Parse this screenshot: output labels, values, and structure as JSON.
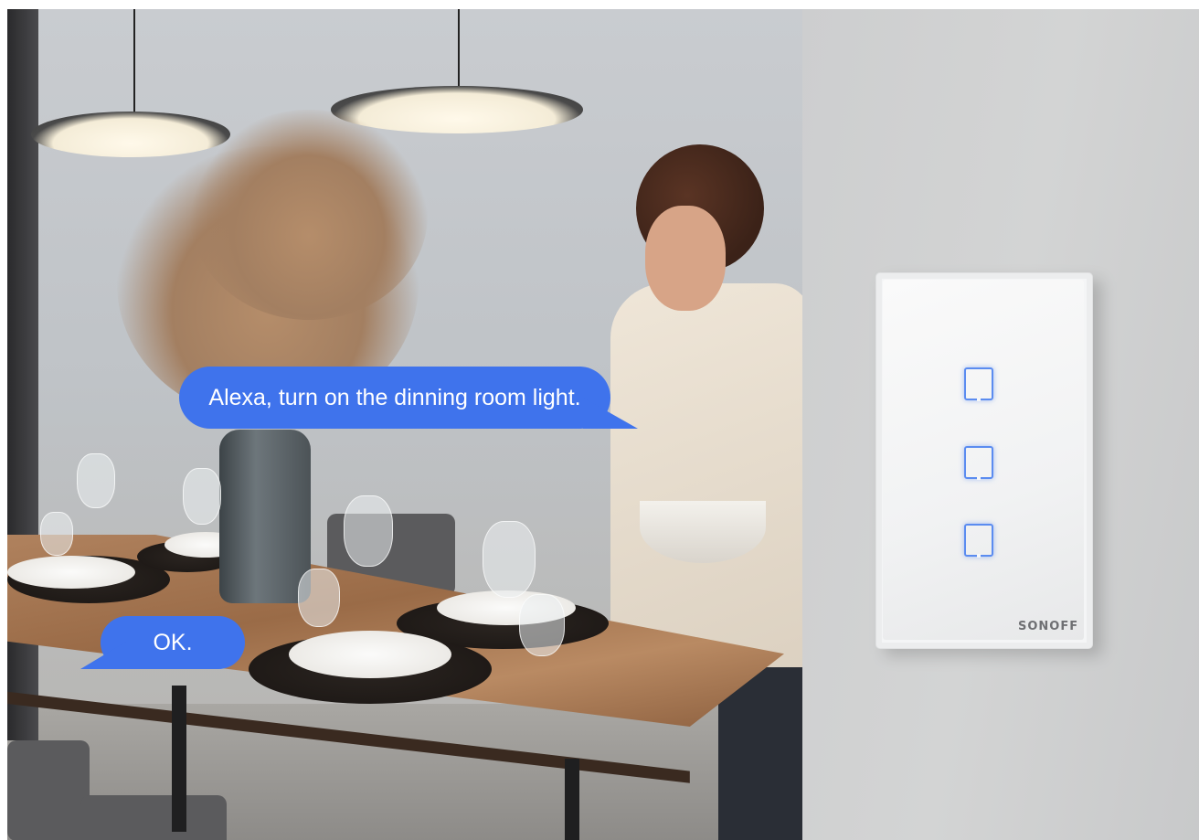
{
  "speech": {
    "request": "Alexa, turn on the dinning room light.",
    "response": "OK."
  },
  "switch": {
    "brand": "SONOFF",
    "touch_keys": 3,
    "key_color": "#5b8cf0"
  },
  "colors": {
    "bubble": "#3f73ec",
    "bubble_text": "#ffffff"
  }
}
